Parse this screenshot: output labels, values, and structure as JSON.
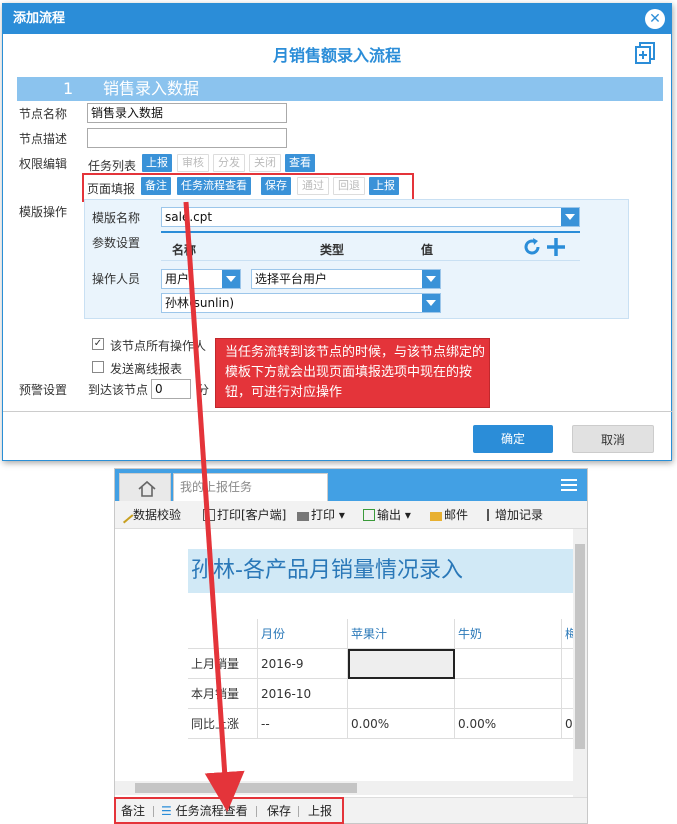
{
  "dialog": {
    "title": "添加流程",
    "heading": "月销售额录入流程",
    "section_num": "1",
    "section_title": "销售录入数据",
    "fields": {
      "node_name_label": "节点名称",
      "node_name_value": "销售录入数据",
      "node_desc_label": "节点描述",
      "node_desc_value": "",
      "permission_label": "权限编辑",
      "task_list_label": "任务列表",
      "task_buttons": [
        "上报",
        "审核",
        "分发",
        "关闭",
        "查看"
      ],
      "page_fill_label": "页面填报",
      "page_buttons": [
        "备注",
        "任务流程查看",
        "保存",
        "通过",
        "回退",
        "上报"
      ],
      "template_op_label": "模版操作",
      "template_name_label": "模版名称",
      "template_name_value": "sale.cpt",
      "param_label": "参数设置",
      "param_cols": [
        "名称",
        "类型",
        "值"
      ],
      "operator_label": "操作人员",
      "operator_type": "用户",
      "operator_platform": "选择平台用户",
      "operator_user": "孙林(sunlin)",
      "check1": "该节点所有操作人",
      "check2": "发送离线报表",
      "alert_label": "预警设置",
      "alert_text1": "到达该节点",
      "alert_value": "0",
      "alert_unit": "分"
    },
    "callout": "当任务流转到该节点的时候，与该节点绑定的模板下方就会出现页面填报选项中现在的按钮，可进行对应操作",
    "ok": "确定",
    "cancel": "取消"
  },
  "report_window": {
    "tab_label": "我的上报任务",
    "toolbar": [
      "数据校验",
      "打印[客户端]",
      "打印",
      "输出",
      "邮件",
      "增加记录"
    ],
    "sheet_title": "孙林-各产品月销量情况录入",
    "table": {
      "headers": [
        "",
        "月份",
        "苹果汁",
        "牛奶",
        "梅"
      ],
      "rows": [
        [
          "上月销量",
          "2016-9",
          "",
          "",
          ""
        ],
        [
          "本月销量",
          "2016-10",
          "",
          "",
          ""
        ],
        [
          "同比上涨",
          "--",
          "0.00%",
          "0.00%",
          "0."
        ]
      ]
    },
    "bottom_buttons": [
      "备注",
      "任务流程查看",
      "保存",
      "上报"
    ]
  },
  "colors": {
    "accent": "#2b8dd8",
    "highlight": "#e4343a",
    "section": "#8bc3ee"
  }
}
